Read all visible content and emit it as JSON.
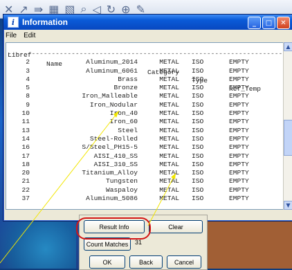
{
  "window": {
    "title": "Information",
    "icon_letter": "i"
  },
  "menu": [
    "File",
    "Edit"
  ],
  "columns": {
    "libref": "Libref",
    "name": "Name",
    "category": "Category",
    "type": "Type",
    "ref_temp": "Ref_Temp"
  },
  "separator": "------------------------------------------------------------------------------",
  "rows": [
    {
      "libref": "2",
      "name": "Aluminum_2014",
      "category": "METAL",
      "type": "ISO",
      "ref_temp": "EMPTY"
    },
    {
      "libref": "3",
      "name": "Aluminum_6061",
      "category": "METAL",
      "type": "ISO",
      "ref_temp": "EMPTY"
    },
    {
      "libref": "4",
      "name": "Brass",
      "category": "METAL",
      "type": "ISO",
      "ref_temp": "EMPTY"
    },
    {
      "libref": "5",
      "name": "Bronze",
      "category": "METAL",
      "type": "ISO",
      "ref_temp": "EMPTY"
    },
    {
      "libref": "8",
      "name": "Iron_Malleable",
      "category": "METAL",
      "type": "ISO",
      "ref_temp": "EMPTY"
    },
    {
      "libref": "9",
      "name": "Iron_Nodular",
      "category": "METAL",
      "type": "ISO",
      "ref_temp": "EMPTY"
    },
    {
      "libref": "10",
      "name": "Iron_40",
      "category": "METAL",
      "type": "ISO",
      "ref_temp": "EMPTY"
    },
    {
      "libref": "11",
      "name": "Iron_60",
      "category": "METAL",
      "type": "ISO",
      "ref_temp": "EMPTY"
    },
    {
      "libref": "13",
      "name": "Steel",
      "category": "METAL",
      "type": "ISO",
      "ref_temp": "EMPTY"
    },
    {
      "libref": "14",
      "name": "Steel-Rolled",
      "category": "METAL",
      "type": "ISO",
      "ref_temp": "EMPTY"
    },
    {
      "libref": "16",
      "name": "S/Steel_PH15-5",
      "category": "METAL",
      "type": "ISO",
      "ref_temp": "EMPTY"
    },
    {
      "libref": "17",
      "name": "AISI_410_SS",
      "category": "METAL",
      "type": "ISO",
      "ref_temp": "EMPTY"
    },
    {
      "libref": "18",
      "name": "AISI_310_SS",
      "category": "METAL",
      "type": "ISO",
      "ref_temp": "EMPTY"
    },
    {
      "libref": "20",
      "name": "Titanium_Alloy",
      "category": "METAL",
      "type": "ISO",
      "ref_temp": "EMPTY"
    },
    {
      "libref": "21",
      "name": "Tungsten",
      "category": "METAL",
      "type": "ISO",
      "ref_temp": "EMPTY"
    },
    {
      "libref": "22",
      "name": "Waspaloy",
      "category": "METAL",
      "type": "ISO",
      "ref_temp": "EMPTY"
    },
    {
      "libref": "37",
      "name": "Aluminum_5086",
      "category": "METAL",
      "type": "ISO",
      "ref_temp": "EMPTY"
    }
  ],
  "buttons": {
    "result_info": "Result Info",
    "clear": "Clear",
    "count_matches": "Count Matches",
    "count_value": "31",
    "ok": "OK",
    "back": "Back",
    "cancel": "Cancel"
  },
  "colors": {
    "titlebar": "#0a5bd8",
    "highlight": "#d41616",
    "annotation_arrow": "#f2e600"
  }
}
